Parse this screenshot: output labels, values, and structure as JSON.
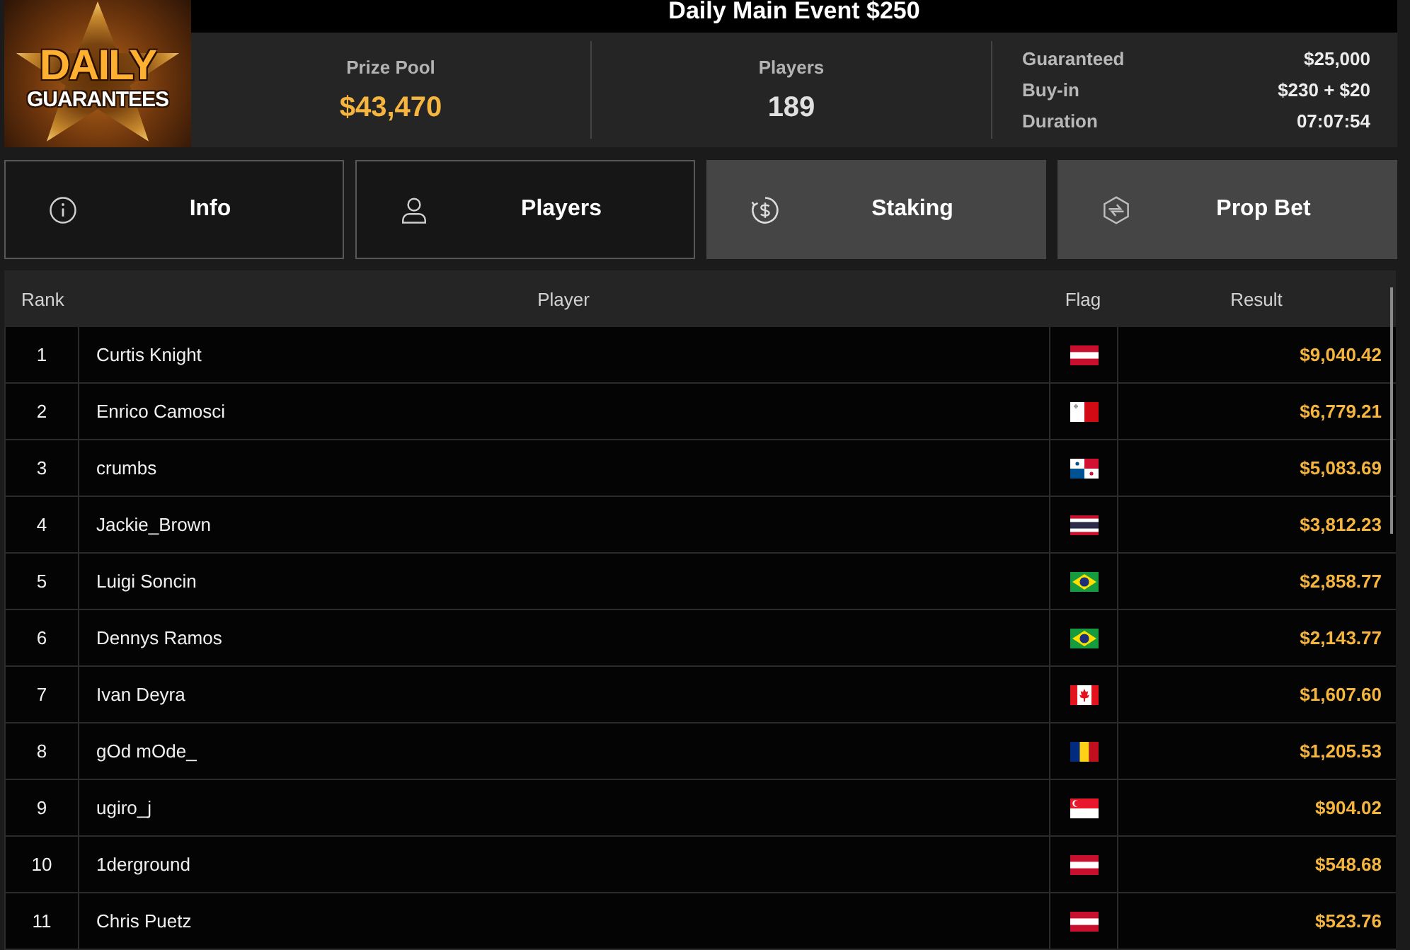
{
  "logo": {
    "line_1": "DAILY",
    "line_2": "GUARANTEES"
  },
  "title": "Daily Main Event $250",
  "stats": {
    "prize_pool": {
      "label": "Prize Pool",
      "value": "$43,470"
    },
    "players": {
      "label": "Players",
      "value": "189"
    },
    "details": [
      {
        "label": "Guaranteed",
        "value": "$25,000"
      },
      {
        "label": "Buy-in",
        "value": "$230 + $20"
      },
      {
        "label": "Duration",
        "value": "07:07:54"
      }
    ]
  },
  "tabs": [
    {
      "label": "Info",
      "kind": "info",
      "highlighted": false
    },
    {
      "label": "Players",
      "kind": "players",
      "highlighted": false
    },
    {
      "label": "Staking",
      "kind": "staking",
      "highlighted": true
    },
    {
      "label": "Prop Bet",
      "kind": "propbet",
      "highlighted": true
    }
  ],
  "table": {
    "columns": [
      "Rank",
      "Player",
      "Flag",
      "Result"
    ],
    "rows": [
      {
        "rank": "1",
        "player": "Curtis Knight",
        "flag": {
          "kind": "austria"
        },
        "result": "$9,040.42"
      },
      {
        "rank": "2",
        "player": "Enrico Camosci",
        "flag": {
          "kind": "malta"
        },
        "result": "$6,779.21"
      },
      {
        "rank": "3",
        "player": "crumbs",
        "flag": {
          "kind": "panama"
        },
        "result": "$5,083.69"
      },
      {
        "rank": "4",
        "player": "Jackie_Brown",
        "flag": {
          "kind": "thailand"
        },
        "result": "$3,812.23"
      },
      {
        "rank": "5",
        "player": "Luigi Soncin",
        "flag": {
          "kind": "brazil"
        },
        "result": "$2,858.77"
      },
      {
        "rank": "6",
        "player": "Dennys Ramos",
        "flag": {
          "kind": "brazil"
        },
        "result": "$2,143.77"
      },
      {
        "rank": "7",
        "player": "Ivan Deyra",
        "flag": {
          "kind": "canada"
        },
        "result": "$1,607.60"
      },
      {
        "rank": "8",
        "player": "gOd mOde_",
        "flag": {
          "kind": "romania"
        },
        "result": "$1,205.53"
      },
      {
        "rank": "9",
        "player": "ugiro_j",
        "flag": {
          "kind": "singapore"
        },
        "result": "$904.02"
      },
      {
        "rank": "10",
        "player": "1derground",
        "flag": {
          "kind": "austria"
        },
        "result": "$548.68"
      },
      {
        "rank": "11",
        "player": "Chris Puetz",
        "flag": {
          "kind": "austria"
        },
        "result": "$523.76"
      }
    ]
  }
}
